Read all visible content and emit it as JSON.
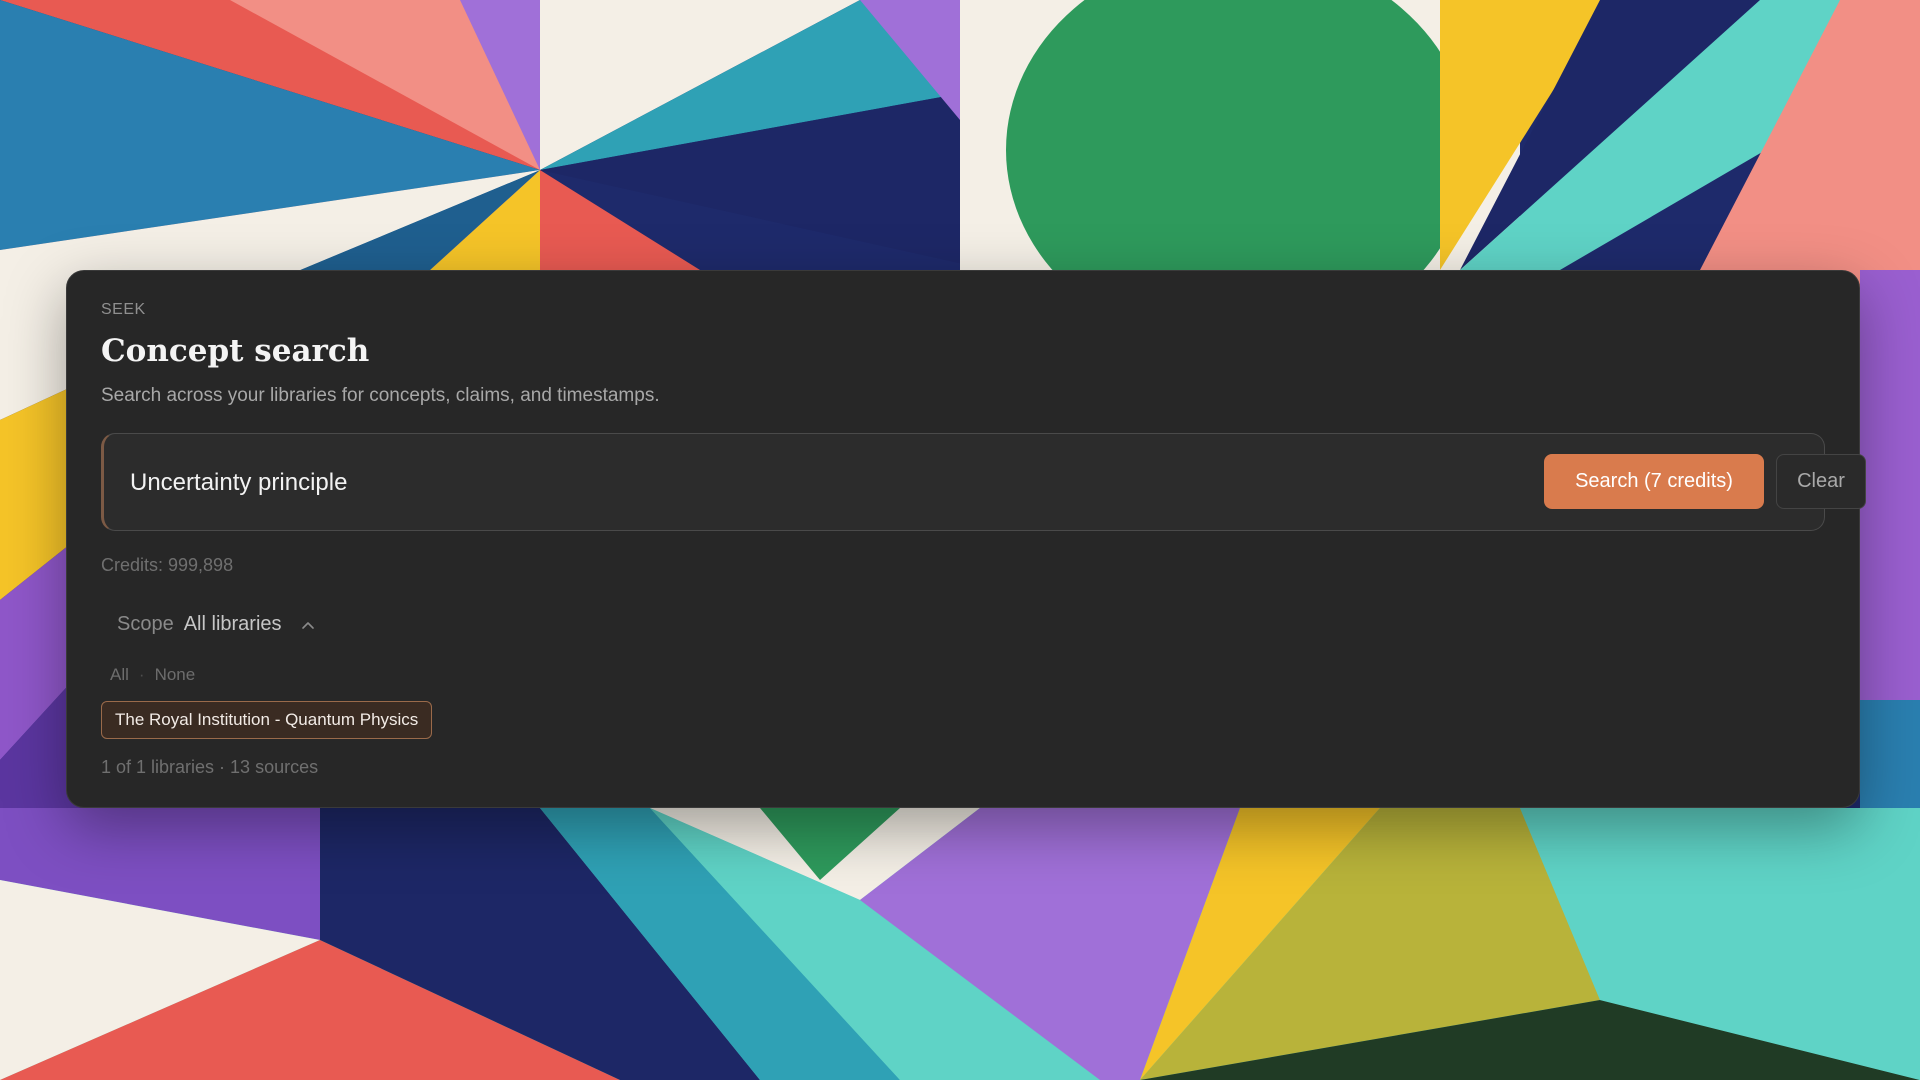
{
  "panel": {
    "eyebrow": "SEEK",
    "title": "Concept search",
    "subtitle": "Search across your libraries for concepts, claims, and timestamps."
  },
  "search": {
    "query": "Uncertainty principle",
    "search_button_label": "Search (7 credits)",
    "clear_button_label": "Clear"
  },
  "credits_text": "Credits: 999,898",
  "scope": {
    "label": "Scope",
    "value": "All libraries",
    "icon": "chevron-up-icon",
    "select_all_label": "All",
    "separator": "·",
    "select_none_label": "None",
    "libraries": [
      {
        "name": "The Royal Institution - Quantum Physics",
        "selected": true
      }
    ],
    "summary": "1 of 1 libraries · 13 sources"
  },
  "colors": {
    "panel_bg": "#272727",
    "accent": "#d97b4d",
    "chip_bg": "#3a2b22",
    "chip_border": "#9a6a4a"
  }
}
